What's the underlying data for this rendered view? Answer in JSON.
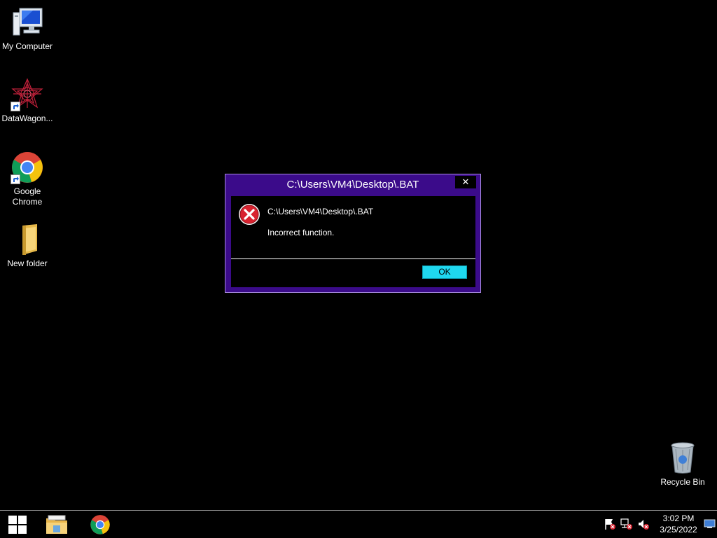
{
  "desktop": {
    "icons": [
      {
        "label": "My Computer"
      },
      {
        "label": "DataWagon..."
      },
      {
        "label": "Google Chrome"
      },
      {
        "label": "New folder"
      },
      {
        "label": "Recycle Bin"
      }
    ]
  },
  "dialog": {
    "title": "C:\\Users\\VM4\\Desktop\\.BAT",
    "close_label": "✕",
    "message_title": "C:\\Users\\VM4\\Desktop\\.BAT",
    "message_text": "Incorrect function.",
    "ok_label": "OK",
    "icon": "error-icon"
  },
  "taskbar": {
    "apps": [
      {
        "name": "file-explorer-icon"
      },
      {
        "name": "chrome-icon"
      }
    ],
    "tray": [
      {
        "name": "action-center-flag-icon"
      },
      {
        "name": "network-icon"
      },
      {
        "name": "volume-muted-icon"
      }
    ],
    "clock": {
      "time": "3:02 PM",
      "date": "3/25/2022"
    }
  },
  "colors": {
    "dialog_frame": "#3b0b8a",
    "ok_button": "#1fd8ef",
    "desktop": "#000000"
  }
}
